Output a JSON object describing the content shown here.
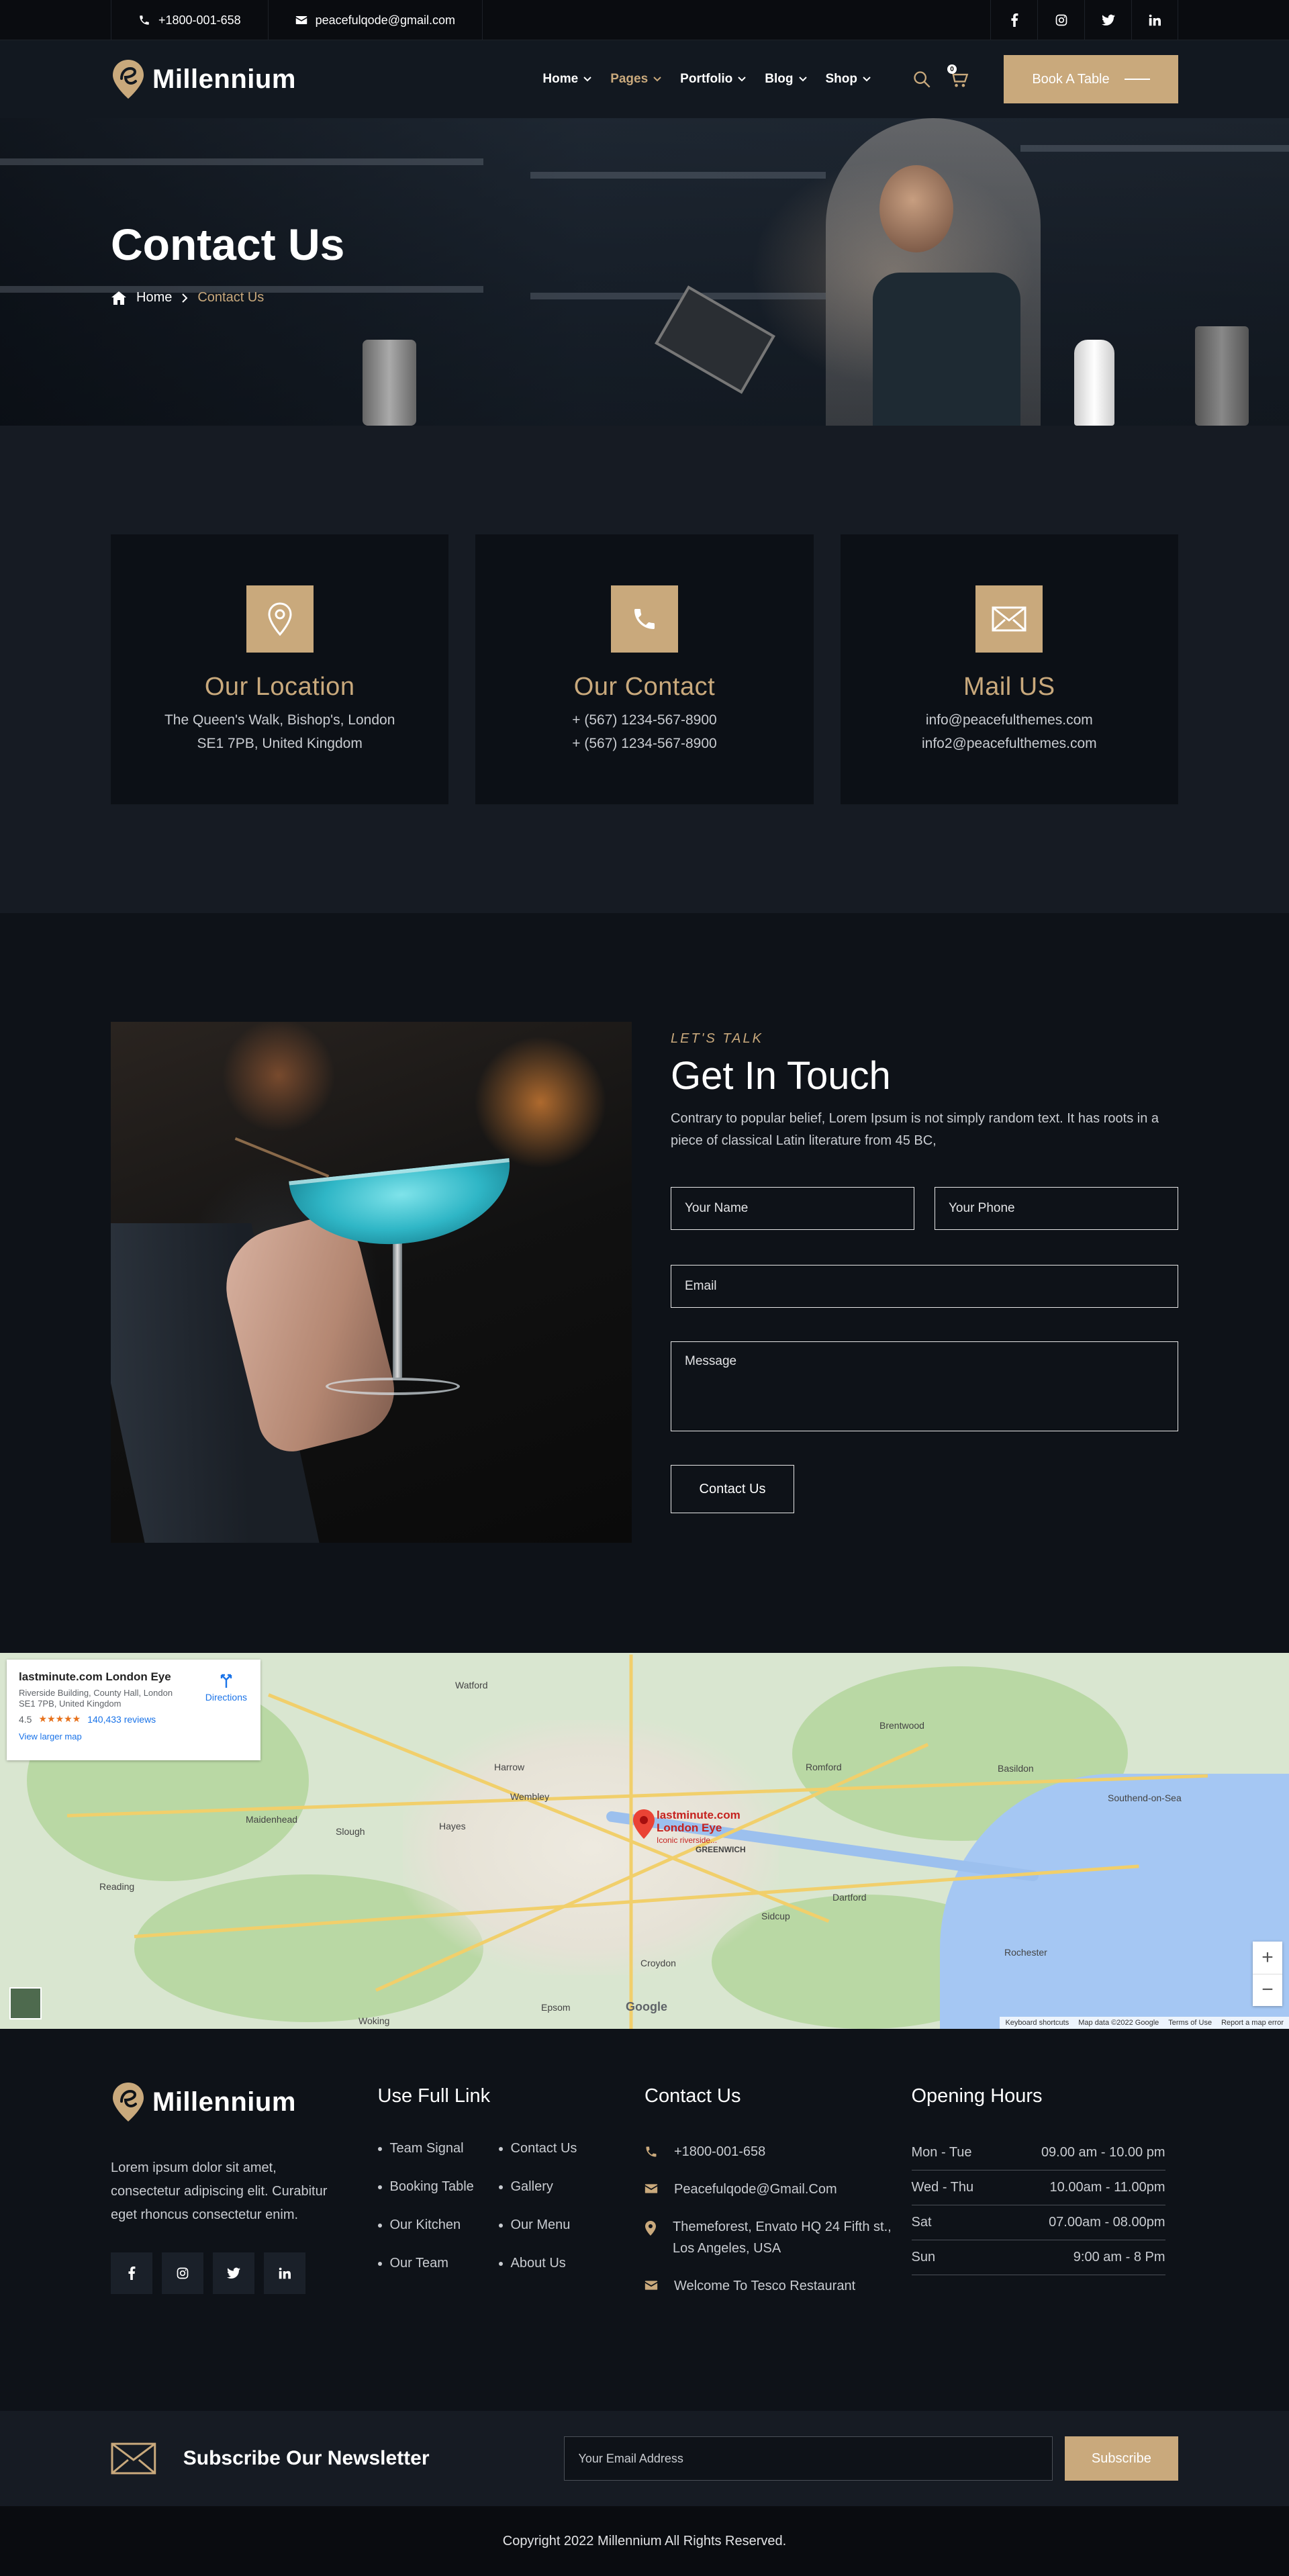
{
  "topbar": {
    "phone": "+1800-001-658",
    "email": "peacefulqode@gmail.com",
    "social": [
      "facebook-icon",
      "instagram-icon",
      "twitter-icon",
      "linkedin-icon"
    ]
  },
  "nav": {
    "brand": "Millennium",
    "menu": [
      {
        "label": "Home",
        "active": false
      },
      {
        "label": "Pages",
        "active": true
      },
      {
        "label": "Portfolio",
        "active": false
      },
      {
        "label": "Blog",
        "active": false
      },
      {
        "label": "Shop",
        "active": false
      }
    ],
    "cart_count": "0",
    "book_label": "Book A Table"
  },
  "hero": {
    "title": "Contact Us",
    "breadcrumb_home": "Home",
    "breadcrumb_current": "Contact Us"
  },
  "cards": [
    {
      "title": "Our Location",
      "line1": "The Queen's Walk, Bishop's, London",
      "line2": "SE1 7PB, United Kingdom"
    },
    {
      "title": "Our Contact",
      "line1": "+ (567) 1234-567-8900",
      "line2": "+ (567) 1234-567-8900"
    },
    {
      "title": "Mail US",
      "line1": "info@peacefulthemes.com",
      "line2": "info2@peacefulthemes.com"
    }
  ],
  "contact": {
    "kicker": "LET'S TALK",
    "title": "Get In Touch",
    "intro": "Contrary to popular belief, Lorem Ipsum is not simply random text. It has roots in a piece of classical Latin literature from 45 BC,",
    "name_placeholder": "Your Name",
    "phone_placeholder": "Your Phone",
    "email_placeholder": "Email",
    "message_placeholder": "Message",
    "submit_label": "Contact Us"
  },
  "map": {
    "place_name": "lastminute.com London Eye",
    "address": "Riverside Building, County Hall, London SE1 7PB, United Kingdom",
    "rating": "4.5",
    "stars": "★★★★★",
    "reviews": "140,433 reviews",
    "larger_map": "View larger map",
    "directions": "Directions",
    "pin_label_1": "lastminute.com",
    "pin_label_2": "London Eye",
    "pin_sub": "Iconic riverside...",
    "google": "Google",
    "footer_1": "Keyboard shortcuts",
    "footer_2": "Map data ©2022 Google",
    "footer_3": "Terms of Use",
    "footer_4": "Report a map error",
    "places": [
      "Watford",
      "Harrow",
      "Wembley",
      "Slough",
      "Hayes",
      "Romford",
      "Basildon",
      "Southend-on-Sea",
      "Maidenhead",
      "Reading",
      "Croydon",
      "Sidcup",
      "Dartford",
      "Rochester",
      "Epsom",
      "Woking",
      "Brentwood",
      "GREENWICH"
    ]
  },
  "footer": {
    "brand": "Millennium",
    "about": "Lorem ipsum dolor sit amet, consectetur adipiscing elit. Curabitur eget rhoncus consectetur enim.",
    "links_title": "Use Full Link",
    "links": [
      "Team Signal",
      "Contact Us",
      "Booking Table",
      "Gallery",
      "Our Kitchen",
      "Our Menu",
      "Our Team",
      "About Us"
    ],
    "contact_title": "Contact Us",
    "contact_phone": "+1800-001-658",
    "contact_email": "Peacefulqode@Gmail.Com",
    "contact_address": "Themeforest, Envato HQ 24 Fifth st., Los Angeles, USA",
    "contact_welcome": "Welcome To Tesco Restaurant",
    "hours_title": "Opening Hours",
    "hours": [
      {
        "day": "Mon - Tue",
        "time": "09.00 am - 10.00 pm"
      },
      {
        "day": "Wed - Thu",
        "time": "10.00am - 11.00pm"
      },
      {
        "day": "Sat",
        "time": "07.00am - 08.00pm"
      },
      {
        "day": "Sun",
        "time": "9:00 am - 8 Pm"
      }
    ]
  },
  "newsletter": {
    "title": "Subscribe Our Newsletter",
    "placeholder": "Your Email Address",
    "button": "Subscribe"
  },
  "copyright": "Copyright 2022 Millennium All Rights Reserved.",
  "colors": {
    "accent": "#c9a97c",
    "background": "#10141a"
  }
}
